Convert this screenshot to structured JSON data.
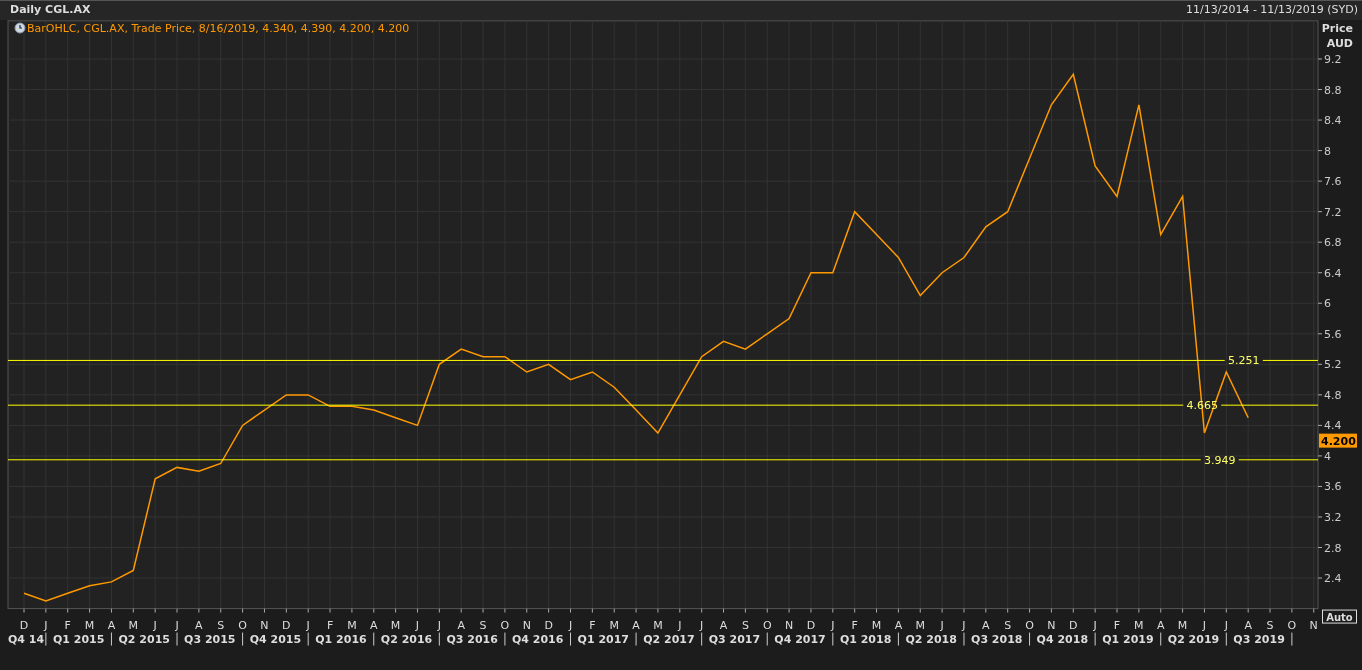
{
  "header": {
    "title": "Daily CGL.AX",
    "date_range": "11/13/2014 - 11/13/2019 (SYD)"
  },
  "chart": {
    "legend": "BarOHLC, CGL.AX, Trade Price, 8/16/2019, 4.340, 4.390, 4.200, 4.200",
    "last_price": "4.200",
    "auto_button": "Auto",
    "quarters": [
      "Q4 14",
      "Q1 2015",
      "Q2 2015",
      "Q3 2015",
      "Q4 2015",
      "Q1 2016",
      "Q2 2016",
      "Q3 2016",
      "Q4 2016",
      "Q1 2017",
      "Q2 2017",
      "Q3 2017",
      "Q4 2017",
      "Q1 2018",
      "Q2 2018",
      "Q3 2018",
      "Q4 2018",
      "Q1 2019",
      "Q2 2019",
      "Q3 2019"
    ],
    "chart_data": {
      "type": "line",
      "ylabel": "Price AUD",
      "categories": [
        "D",
        "J",
        "F",
        "M",
        "A",
        "M",
        "J",
        "J",
        "A",
        "S",
        "O",
        "N",
        "D",
        "J",
        "F",
        "M",
        "A",
        "M",
        "J",
        "J",
        "A",
        "S",
        "O",
        "N",
        "D",
        "J",
        "F",
        "M",
        "A",
        "M",
        "J",
        "J",
        "A",
        "S",
        "O",
        "N",
        "D",
        "J",
        "F",
        "M",
        "A",
        "M",
        "J",
        "J",
        "A",
        "S",
        "O",
        "N",
        "D",
        "J",
        "F",
        "M",
        "A",
        "M",
        "J",
        "J",
        "A",
        "S",
        "O",
        "N"
      ],
      "grid": true,
      "series": [
        {
          "color": "#ff9900",
          "values": [
            2.2,
            2.1,
            2.2,
            2.3,
            2.35,
            2.5,
            3.7,
            3.85,
            3.8,
            3.9,
            4.4,
            4.6,
            4.8,
            4.8,
            4.65,
            4.65,
            4.6,
            4.5,
            4.4,
            5.2,
            5.4,
            5.3,
            5.3,
            5.1,
            5.2,
            5.0,
            5.1,
            4.9,
            4.6,
            4.3,
            4.8,
            5.3,
            5.5,
            5.4,
            5.6,
            5.8,
            6.4,
            6.4,
            7.2,
            6.9,
            6.6,
            6.1,
            6.4,
            6.6,
            7.0,
            7.2,
            7.9,
            8.6,
            9.0,
            7.8,
            7.4,
            8.6,
            6.9,
            7.4,
            4.3,
            5.1,
            4.5,
            null,
            null,
            null
          ]
        }
      ],
      "ylim": [
        2.0,
        9.7
      ],
      "yticks": [
        {
          "value": 2.4,
          "label": "2.4"
        },
        {
          "value": 2.8,
          "label": "2.8"
        },
        {
          "value": 3.2,
          "label": "3.2"
        },
        {
          "value": 3.6,
          "label": "3.6"
        },
        {
          "value": 4,
          "label": "4"
        },
        {
          "value": 4.4,
          "label": "4.4"
        },
        {
          "value": 4.8,
          "label": "4.8"
        },
        {
          "value": 5.2,
          "label": "5.2"
        },
        {
          "value": 5.6,
          "label": "5.6"
        },
        {
          "value": 6,
          "label": "6"
        },
        {
          "value": 6.4,
          "label": "6.4"
        },
        {
          "value": 6.8,
          "label": "6.8"
        },
        {
          "value": 7.2,
          "label": "7.2"
        },
        {
          "value": 7.6,
          "label": "7.6"
        },
        {
          "value": 8,
          "label": "8"
        },
        {
          "value": 8.4,
          "label": "8.4"
        },
        {
          "value": 8.8,
          "label": "8.8"
        },
        {
          "value": 9.2,
          "label": "9.2"
        }
      ],
      "ref_lines": [
        {
          "axis": "y",
          "value": 5.251,
          "label": "5.251"
        },
        {
          "axis": "y",
          "value": 4.665,
          "label": "4.665"
        },
        {
          "axis": "y",
          "value": 3.949,
          "label": "3.949"
        }
      ]
    }
  }
}
